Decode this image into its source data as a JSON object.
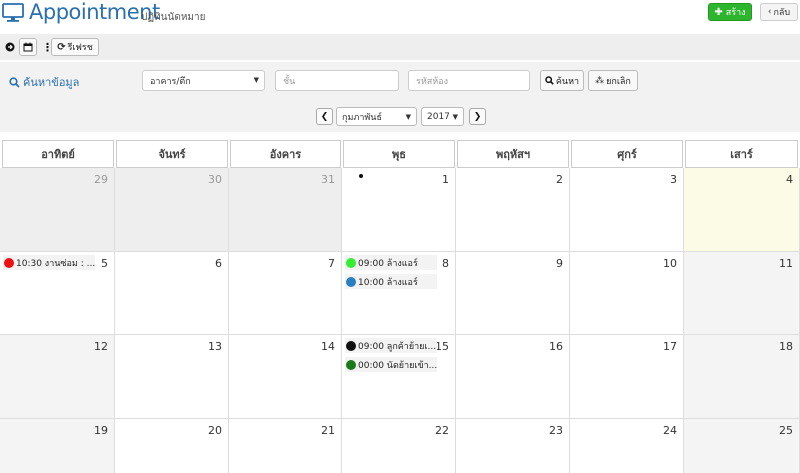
{
  "header": {
    "title": "Appointment",
    "subtitle": "ปฏิทินนัดหมาย",
    "create_label": "สร้าง",
    "back_label": "กลับ"
  },
  "toolbar": {
    "refresh_label": "รีเฟรช"
  },
  "search": {
    "label": "ค้นหาข้อมูล",
    "building_value": "อาคาร/ตึก",
    "floor_placeholder": "ชั้น",
    "room_placeholder": "รหัสห้อง",
    "search_button": "ค้นหา",
    "cancel_button": "ยกเลิก"
  },
  "nav": {
    "month": "กุมภาพันธ์",
    "year": "2017"
  },
  "weekdays": [
    "อาทิตย์",
    "จันทร์",
    "อังคาร",
    "พุธ",
    "พฤหัสฯ",
    "ศุกร์",
    "เสาร์"
  ],
  "weeks": [
    [
      {
        "day": "29",
        "type": "other",
        "events": []
      },
      {
        "day": "30",
        "type": "other",
        "events": []
      },
      {
        "day": "31",
        "type": "other",
        "events": []
      },
      {
        "day": "1",
        "type": "normal",
        "marker": true,
        "events": []
      },
      {
        "day": "2",
        "type": "normal",
        "events": []
      },
      {
        "day": "3",
        "type": "normal",
        "events": []
      },
      {
        "day": "4",
        "type": "today",
        "events": []
      }
    ],
    [
      {
        "day": "5",
        "type": "normal",
        "events": [
          {
            "text": "10:30 งานซ่อม : ...",
            "color": "#ee1111"
          }
        ]
      },
      {
        "day": "6",
        "type": "normal",
        "events": []
      },
      {
        "day": "7",
        "type": "normal",
        "events": []
      },
      {
        "day": "8",
        "type": "normal",
        "events": [
          {
            "text": "09:00 ล้างแอร์",
            "color": "#33ee33"
          },
          {
            "text": "10:00 ล้างแอร์",
            "color": "#2a7fc0"
          }
        ]
      },
      {
        "day": "9",
        "type": "normal",
        "events": []
      },
      {
        "day": "10",
        "type": "normal",
        "events": []
      },
      {
        "day": "11",
        "type": "grey",
        "events": []
      }
    ],
    [
      {
        "day": "12",
        "type": "grey",
        "events": []
      },
      {
        "day": "13",
        "type": "normal",
        "events": []
      },
      {
        "day": "14",
        "type": "normal",
        "events": []
      },
      {
        "day": "15",
        "type": "normal",
        "events": [
          {
            "text": "09:00 ลูกค้าย้ายเ...",
            "color": "#111111"
          },
          {
            "text": "00:00 นัดย้ายเข้า...",
            "color": "#1a7a1a"
          }
        ]
      },
      {
        "day": "16",
        "type": "normal",
        "events": []
      },
      {
        "day": "17",
        "type": "normal",
        "events": []
      },
      {
        "day": "18",
        "type": "grey",
        "events": []
      }
    ],
    [
      {
        "day": "19",
        "type": "grey",
        "events": []
      },
      {
        "day": "20",
        "type": "normal",
        "events": []
      },
      {
        "day": "21",
        "type": "normal",
        "events": []
      },
      {
        "day": "22",
        "type": "normal",
        "events": []
      },
      {
        "day": "23",
        "type": "normal",
        "events": []
      },
      {
        "day": "24",
        "type": "normal",
        "events": []
      },
      {
        "day": "25",
        "type": "grey",
        "events": []
      }
    ]
  ],
  "colors": {
    "title": "#2a6fb0",
    "create_button": "#2db52d",
    "today_bg": "#fbfbe6"
  }
}
